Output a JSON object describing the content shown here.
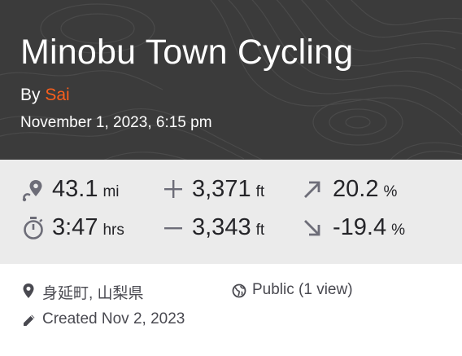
{
  "activity": {
    "title": "Minobu Town Cycling",
    "by_label": "By",
    "author": "Sai",
    "datetime": "November 1, 2023, 6:15 pm"
  },
  "stats": {
    "distance": {
      "value": "43.1",
      "unit": "mi",
      "icon": "route-pin-icon"
    },
    "elevation_gain": {
      "value": "3,371",
      "unit": "ft",
      "icon": "plus-icon"
    },
    "max_grade": {
      "value": "20.2",
      "unit": "%",
      "icon": "arrow-up-right-icon"
    },
    "moving_time": {
      "value": "3:47",
      "unit": "hrs",
      "icon": "stopwatch-icon"
    },
    "elevation_loss": {
      "value": "3,343",
      "unit": "ft",
      "icon": "minus-icon"
    },
    "min_grade": {
      "value": "-19.4",
      "unit": "%",
      "icon": "arrow-down-right-icon"
    }
  },
  "details": {
    "location": "身延町, 山梨県",
    "visibility": "Public (1 view)",
    "created": "Created Nov 2, 2023"
  },
  "colors": {
    "header_bg": "#3b3b3b",
    "stats_bg": "#ebebeb",
    "accent": "#fc5f1c",
    "icon": "#6d6d78"
  }
}
